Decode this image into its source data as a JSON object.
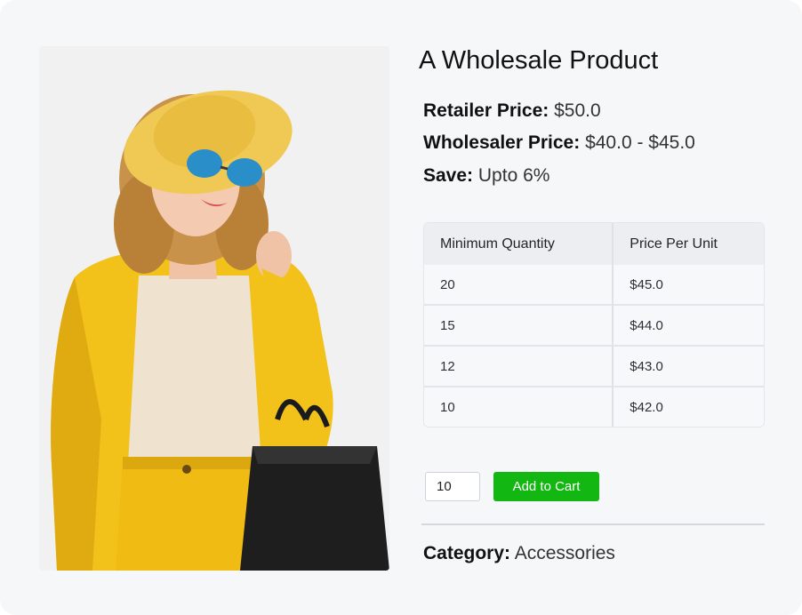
{
  "product": {
    "title": "A Wholesale Product",
    "image_alt": "Woman in yellow outfit with hat, sunglasses and black tote bag"
  },
  "pricing": {
    "retailer_label": "Retailer Price:",
    "retailer_value": "$50.0",
    "wholesaler_label": "Wholesaler Price:",
    "wholesaler_value": "$40.0 - $45.0",
    "save_label": "Save:",
    "save_value": "Upto 6%"
  },
  "tiers": {
    "headers": [
      "Minimum Quantity",
      "Price Per Unit"
    ],
    "rows": [
      {
        "quantity": "20",
        "price": "$45.0"
      },
      {
        "quantity": "15",
        "price": "$44.0"
      },
      {
        "quantity": "12",
        "price": "$43.0"
      },
      {
        "quantity": "10",
        "price": "$42.0"
      }
    ]
  },
  "cart": {
    "quantity_value": "10",
    "add_label": "Add to Cart"
  },
  "meta": {
    "category_label": "Category:",
    "category_value": "Accessories"
  },
  "colors": {
    "accent": "#12b712",
    "card_background": "#f6f7f9"
  }
}
